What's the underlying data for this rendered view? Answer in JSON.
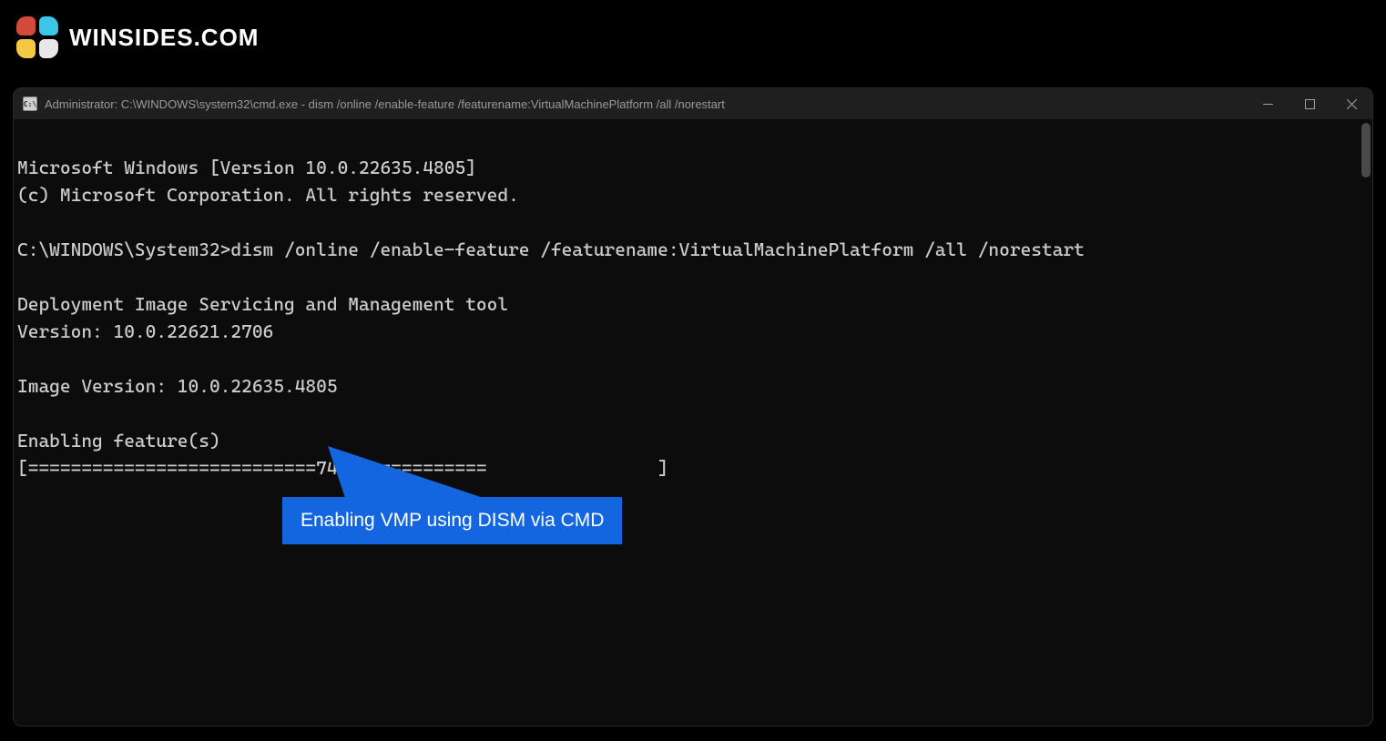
{
  "brand": {
    "text": "WINSIDES.COM"
  },
  "window": {
    "title": "Administrator: C:\\WINDOWS\\system32\\cmd.exe - dism  /online /enable-feature /featurename:VirtualMachinePlatform /all /norestart"
  },
  "terminal": {
    "line1": "Microsoft Windows [Version 10.0.22635.4805]",
    "line2": "(c) Microsoft Corporation. All rights reserved.",
    "line3": "",
    "line4": "C:\\WINDOWS\\System32>dism /online /enable-feature /featurename:VirtualMachinePlatform /all /norestart",
    "line5": "",
    "line6": "Deployment Image Servicing and Management tool",
    "line7": "Version: 10.0.22621.2706",
    "line8": "",
    "line9": "Image Version: 10.0.22635.4805",
    "line10": "",
    "line11": "Enabling feature(s)",
    "line12": "[===========================74.2%===========                ]"
  },
  "callout": {
    "text": "Enabling VMP using DISM via CMD"
  }
}
